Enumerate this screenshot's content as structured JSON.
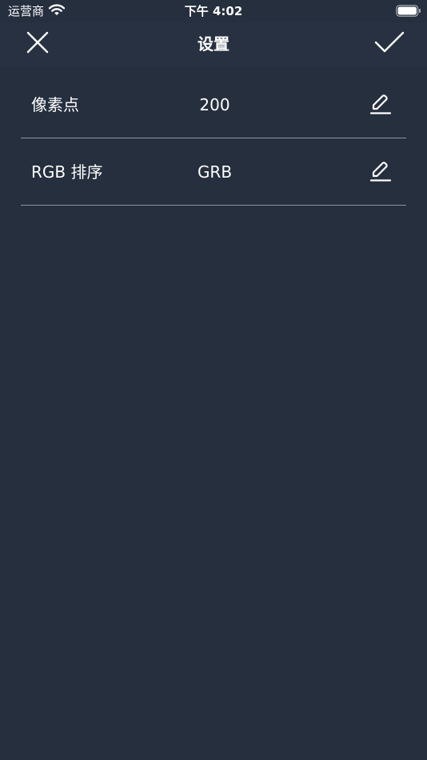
{
  "status_bar": {
    "carrier": "运营商",
    "time": "下午 4:02"
  },
  "nav_bar": {
    "title": "设置",
    "left_icon": "close-icon",
    "right_icon": "checkmark-icon"
  },
  "settings": [
    {
      "label": "像素点",
      "value": "200",
      "icon": "edit-pencil-icon"
    },
    {
      "label": "RGB 排序",
      "value": "GRB",
      "icon": "edit-pencil-icon"
    }
  ],
  "colors": {
    "background": "#252f3e",
    "nav_background": "#273141",
    "divider": "#8a93a1",
    "text": "#ffffff"
  }
}
